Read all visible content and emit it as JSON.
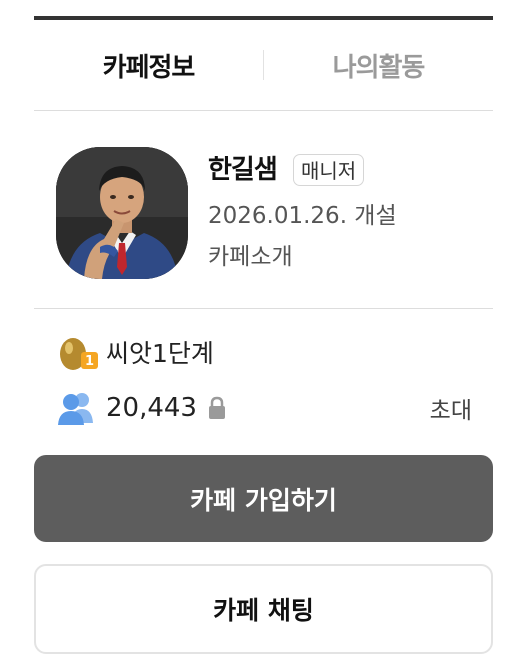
{
  "tabs": [
    {
      "label": "카페정보",
      "active": true
    },
    {
      "label": "나의활동",
      "active": false
    }
  ],
  "profile": {
    "manager_name": "한길샘",
    "role_badge": "매니저",
    "created": "2026.01.26. 개설",
    "intro_link": "카페소개",
    "avatar_icon": "manager-photo"
  },
  "stats": {
    "level_icon": "seed-level-icon",
    "level": "씨앗1단계",
    "members_icon": "members-icon",
    "member_count": "20,443",
    "lock_icon": "lock-icon",
    "invite": "초대"
  },
  "buttons": {
    "join": "카페 가입하기",
    "chat": "카페 채팅"
  },
  "colors": {
    "tab_inactive": "#9a9a9a",
    "join_button_bg": "#5d5d5d",
    "members_icon": "#5b9ae8",
    "level_egg": "#b58a2f",
    "level_badge": "#f5a623"
  }
}
